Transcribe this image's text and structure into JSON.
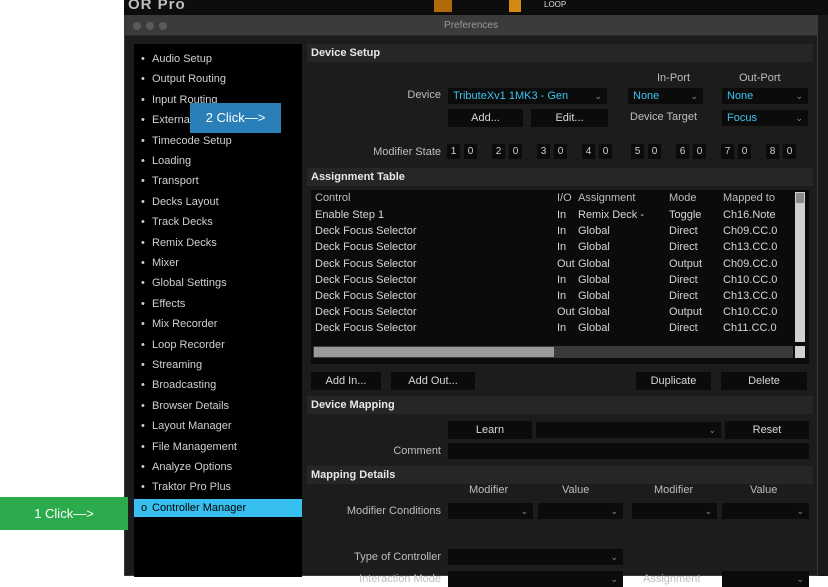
{
  "app": {
    "logo_text": "OR Pro",
    "strip_mark": "LOOP"
  },
  "window": {
    "title": "Preferences"
  },
  "sidebar": {
    "items": [
      {
        "label": "Audio Setup"
      },
      {
        "label": "Output Routing"
      },
      {
        "label": "Input Routing"
      },
      {
        "label": "External Sync"
      },
      {
        "label": "Timecode Setup"
      },
      {
        "label": "Loading"
      },
      {
        "label": "Transport"
      },
      {
        "label": "Decks Layout"
      },
      {
        "label": "Track Decks"
      },
      {
        "label": "Remix Decks"
      },
      {
        "label": "Mixer"
      },
      {
        "label": "Global Settings"
      },
      {
        "label": "Effects"
      },
      {
        "label": "Mix Recorder"
      },
      {
        "label": "Loop Recorder"
      },
      {
        "label": "Streaming"
      },
      {
        "label": "Broadcasting"
      },
      {
        "label": "Browser Details"
      },
      {
        "label": "Layout Manager"
      },
      {
        "label": "File Management"
      },
      {
        "label": "Analyze Options"
      },
      {
        "label": "Traktor Pro Plus"
      },
      {
        "label": "Controller Manager",
        "active": true
      }
    ],
    "bullet": "•",
    "active_bullet": "o"
  },
  "device_setup": {
    "title": "Device Setup",
    "device_label": "Device",
    "device_value": "TributeXv1 1MK3 - Gen",
    "in_port_label": "In-Port",
    "out_port_label": "Out-Port",
    "in_port_value": "None",
    "out_port_value": "None",
    "add_button": "Add...",
    "edit_button": "Edit...",
    "device_target_label": "Device Target",
    "device_target_value": "Focus",
    "modifier_state_label": "Modifier State",
    "modifier_state": [
      "1",
      "0",
      "2",
      "0",
      "3",
      "0",
      "4",
      "0",
      "5",
      "0",
      "6",
      "0",
      "7",
      "0",
      "8",
      "0"
    ]
  },
  "assignment_table": {
    "title": "Assignment Table",
    "columns": [
      "Control",
      "I/O",
      "Assignment",
      "Mode",
      "Mapped to"
    ],
    "rows": [
      [
        "Enable Step 1",
        "In",
        "Remix Deck -",
        "Toggle",
        "Ch16.Note"
      ],
      [
        "Deck Focus Selector",
        "In",
        "Global",
        "Direct",
        "Ch09.CC.0"
      ],
      [
        "Deck Focus Selector",
        "In",
        "Global",
        "Direct",
        "Ch13.CC.0"
      ],
      [
        "Deck Focus Selector",
        "Out",
        "Global",
        "Output",
        "Ch09.CC.0"
      ],
      [
        "Deck Focus Selector",
        "In",
        "Global",
        "Direct",
        "Ch10.CC.0"
      ],
      [
        "Deck Focus Selector",
        "In",
        "Global",
        "Direct",
        "Ch13.CC.0"
      ],
      [
        "Deck Focus Selector",
        "Out",
        "Global",
        "Output",
        "Ch10.CC.0"
      ],
      [
        "Deck Focus Selector",
        "In",
        "Global",
        "Direct",
        "Ch11.CC.0"
      ]
    ],
    "add_in_button": "Add In...",
    "add_out_button": "Add Out...",
    "duplicate_button": "Duplicate",
    "delete_button": "Delete"
  },
  "device_mapping": {
    "title": "Device Mapping",
    "learn_button": "Learn",
    "reset_button": "Reset",
    "comment_label": "Comment",
    "comment_value": ""
  },
  "mapping_details": {
    "title": "Mapping Details",
    "col_modifier_1": "Modifier",
    "col_value_1": "Value",
    "col_modifier_2": "Modifier",
    "col_value_2": "Value",
    "modifier_conditions_label": "Modifier Conditions",
    "type_of_controller_label": "Type of Controller",
    "interaction_mode_label": "Interaction Mode",
    "assignment_label": "Assignment"
  },
  "overlays": {
    "callout_2": "2 Click—>",
    "callout_1": "1 Click—>"
  },
  "icons": {
    "dropdown": "chevron-down-icon",
    "window_controls": "traffic-light-icon"
  }
}
